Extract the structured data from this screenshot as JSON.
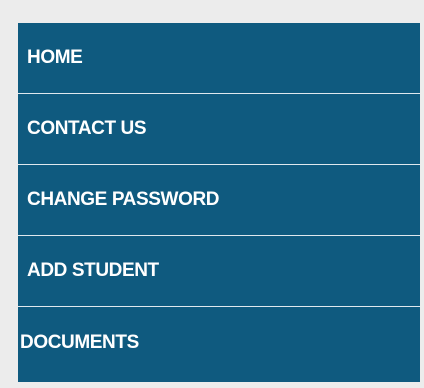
{
  "nav": {
    "items": [
      {
        "label": "HOME"
      },
      {
        "label": "CONTACT US"
      },
      {
        "label": "CHANGE PASSWORD"
      },
      {
        "label": "ADD STUDENT"
      },
      {
        "label": "DOCUMENTS"
      }
    ]
  },
  "colors": {
    "page_background": "#ececec",
    "menu_background": "#0f5a7f",
    "menu_text": "#ffffff",
    "divider": "#dfe8ee"
  }
}
